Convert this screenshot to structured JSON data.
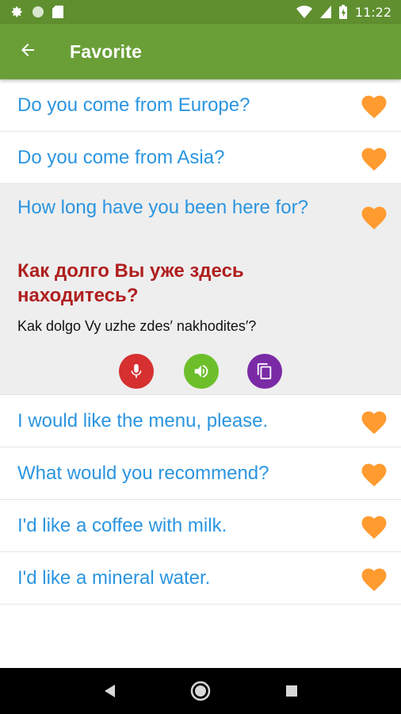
{
  "status_bar": {
    "time": "11:22",
    "icons": [
      "settings-icon",
      "circle-icon",
      "sd-card-icon",
      "wifi-icon",
      "signal-icon",
      "battery-icon"
    ]
  },
  "app_bar": {
    "title": "Favorite",
    "back_icon": "arrow-left-icon"
  },
  "phrases": {
    "items": [
      {
        "text": "Do you come from Europe?"
      },
      {
        "text": "Do you come from Asia?"
      },
      {
        "text": "How long have you been here for?",
        "translation": "Как долго Вы уже здесь находитесь?",
        "transliteration": "Kak dolgo Vy uzhe zdes′ nakhodites′?",
        "expanded": true
      },
      {
        "text": "I would like the menu, please."
      },
      {
        "text": "What would you recommend?"
      },
      {
        "text": "I'd like a coffee with milk."
      },
      {
        "text": "I'd like a mineral water."
      }
    ]
  },
  "actions": {
    "mic_icon": "microphone-icon",
    "speaker_icon": "speaker-icon",
    "copy_icon": "copy-icon"
  },
  "colors": {
    "status_bar": "#5f8f2f",
    "app_bar": "#6a9f38",
    "phrase_text": "#2b95e0",
    "translation_text": "#b01f1f",
    "heart": "#ff9b2f",
    "expanded_bg": "#eeeeee",
    "mic_button": "#d63030",
    "speaker_button": "#6cbf2a",
    "copy_button": "#7b2aa6"
  },
  "nav_bar": {
    "icons": [
      "back-triangle-icon",
      "home-circle-icon",
      "recents-square-icon"
    ]
  }
}
